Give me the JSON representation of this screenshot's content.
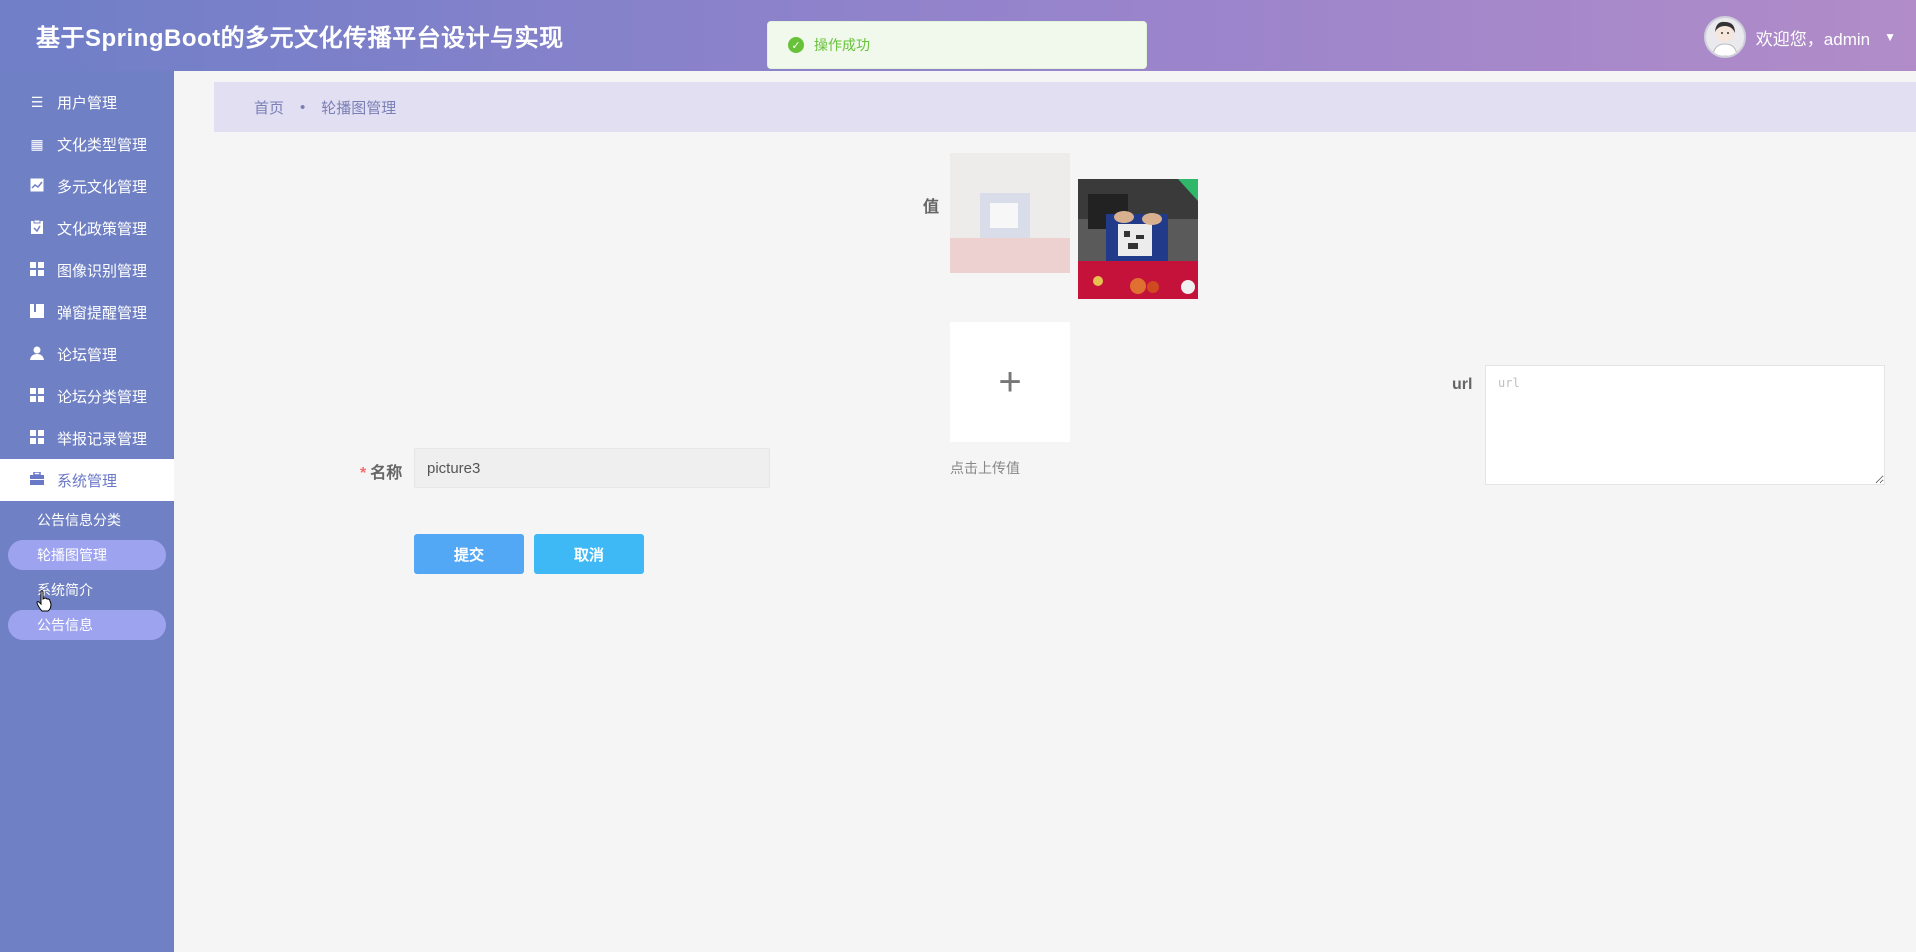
{
  "header": {
    "title": "基于SpringBoot的多元文化传播平台设计与实现",
    "welcome": "欢迎您，admin"
  },
  "toast": {
    "message": "操作成功"
  },
  "sidebar": {
    "items": [
      {
        "label": "用户管理",
        "icon": "list-icon"
      },
      {
        "label": "文化类型管理",
        "icon": "grid-icon"
      },
      {
        "label": "多元文化管理",
        "icon": "chart-icon"
      },
      {
        "label": "文化政策管理",
        "icon": "clipboard-icon"
      },
      {
        "label": "图像识别管理",
        "icon": "apps-icon"
      },
      {
        "label": "弹窗提醒管理",
        "icon": "book-icon"
      },
      {
        "label": "论坛管理",
        "icon": "user-icon"
      },
      {
        "label": "论坛分类管理",
        "icon": "apps-icon"
      },
      {
        "label": "举报记录管理",
        "icon": "apps-icon"
      },
      {
        "label": "系统管理",
        "icon": "briefcase-icon"
      }
    ],
    "submenu": [
      {
        "label": "公告信息分类"
      },
      {
        "label": "轮播图管理"
      },
      {
        "label": "系统简介"
      },
      {
        "label": "公告信息"
      }
    ]
  },
  "breadcrumb": {
    "home": "首页",
    "separator": "•",
    "current": "轮播图管理"
  },
  "form": {
    "value_label": "值",
    "upload_hint": "点击上传值",
    "url_label": "url",
    "url_placeholder": "url",
    "name_label": "名称",
    "name_value": "picture3",
    "submit_label": "提交",
    "cancel_label": "取消"
  },
  "colors": {
    "sidebar": "#7080c4",
    "header_start": "#6f7fc8",
    "header_end": "#b18cc8",
    "submit": "#52a8f5",
    "cancel": "#3eb9f5",
    "success": "#67c23a"
  }
}
